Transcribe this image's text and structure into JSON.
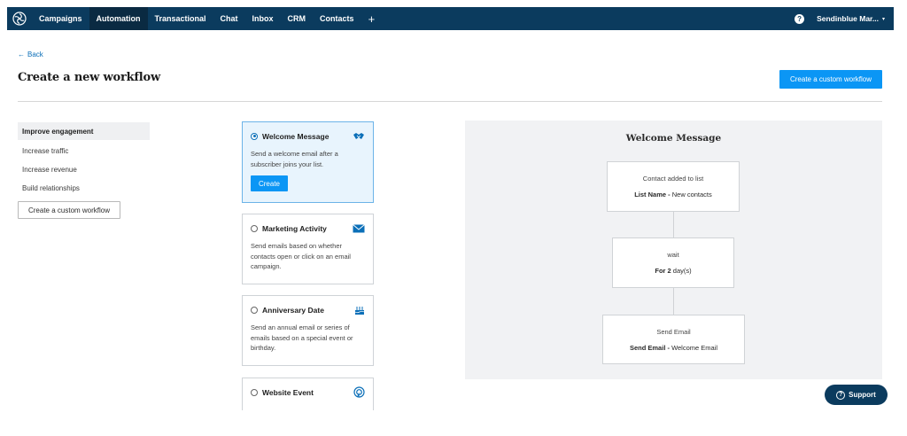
{
  "nav": {
    "items": [
      "Campaigns",
      "Automation",
      "Transactional",
      "Chat",
      "Inbox",
      "CRM",
      "Contacts"
    ],
    "active": "Automation",
    "plus": "+",
    "help": "?",
    "account": "Sendinblue Mar...",
    "caret": "▾"
  },
  "header": {
    "back": "Back",
    "title": "Create a new workflow",
    "create_custom": "Create a custom workflow"
  },
  "sidebar": {
    "items": [
      "Improve engagement",
      "Increase traffic",
      "Increase revenue",
      "Build relationships"
    ],
    "active": "Improve engagement",
    "custom_button": "Create a custom workflow"
  },
  "cards": [
    {
      "title": "Welcome Message",
      "desc": "Send a welcome email after a subscriber joins your list.",
      "icon": "handshake-icon",
      "selected": true,
      "button": "Create"
    },
    {
      "title": "Marketing Activity",
      "desc": "Send emails based on whether contacts open or click on an email campaign.",
      "icon": "envelope-icon",
      "selected": false
    },
    {
      "title": "Anniversary Date",
      "desc": "Send an annual email or series of emails based on a special event or birthday.",
      "icon": "cake-icon",
      "selected": false
    },
    {
      "title": "Website Event",
      "desc": "",
      "icon": "target-cursor-icon",
      "selected": false
    }
  ],
  "preview": {
    "title": "Welcome Message",
    "steps": [
      {
        "line1": "Contact added to list",
        "bold": "List Name -",
        "rest": " New contacts"
      },
      {
        "line1": "wait",
        "bold": "For 2",
        "rest": " day(s)"
      },
      {
        "line1": "Send Email",
        "bold": "Send Email -",
        "rest": " Welcome Email"
      }
    ]
  },
  "support": {
    "label": "Support",
    "icon": "?"
  },
  "colors": {
    "nav_bg": "#0b3b5e",
    "primary": "#0b96f5",
    "link": "#0b6fb8"
  }
}
